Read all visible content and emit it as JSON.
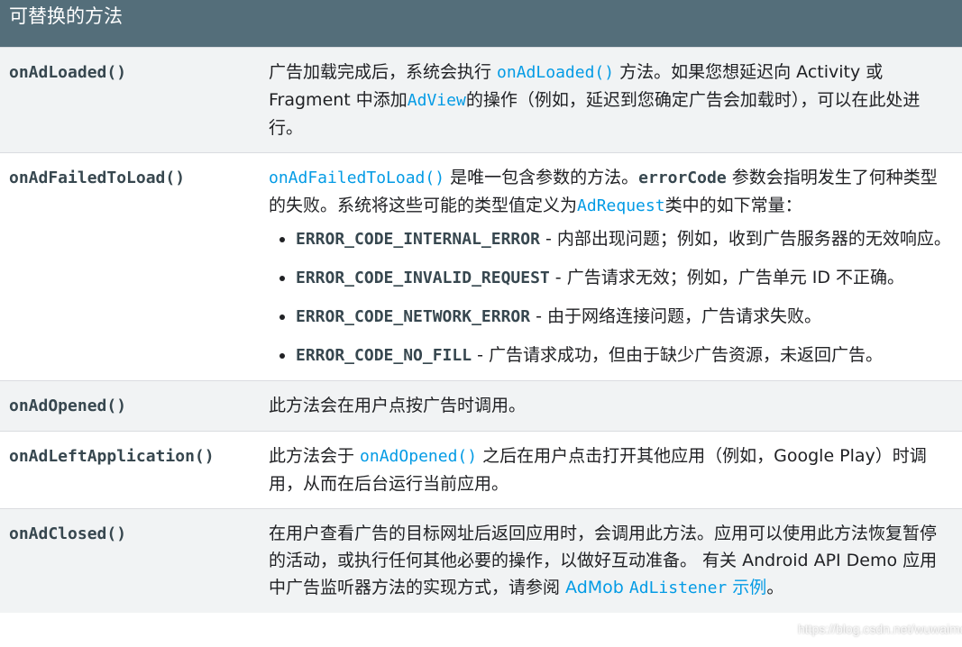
{
  "table": {
    "header_title": "可替换的方法",
    "rows": [
      {
        "method": "onAdLoaded()",
        "desc_pre": "广告加载完成后，系统会执行 ",
        "desc_link": "onAdLoaded()",
        "desc_mid": " 方法。如果您想延迟向 Activity 或 Fragment 中添加",
        "desc_link2": "AdView",
        "desc_post": "的操作（例如，延迟到您确定广告会加载时），可以在此处进行。"
      },
      {
        "method": "onAdFailedToLoad()",
        "desc_link": "onAdFailedToLoad()",
        "desc_mid": " 是唯一包含参数的方法。",
        "desc_code": "errorCode",
        "desc_mid2": " 参数会指明发生了何种类型的失败。系统将这些可能的类型值定义为",
        "desc_link2": "AdRequest",
        "desc_post": "类中的如下常量：",
        "errors": [
          {
            "code": "ERROR_CODE_INTERNAL_ERROR",
            "text": " - 内部出现问题；例如，收到广告服务器的无效响应。"
          },
          {
            "code": "ERROR_CODE_INVALID_REQUEST",
            "text": " - 广告请求无效；例如，广告单元 ID 不正确。"
          },
          {
            "code": "ERROR_CODE_NETWORK_ERROR",
            "text": " - 由于网络连接问题，广告请求失败。"
          },
          {
            "code": "ERROR_CODE_NO_FILL",
            "text": " - 广告请求成功，但由于缺少广告资源，未返回广告。"
          }
        ]
      },
      {
        "method": "onAdOpened()",
        "desc": "此方法会在用户点按广告时调用。"
      },
      {
        "method": "onAdLeftApplication()",
        "desc_pre": "此方法会于 ",
        "desc_link": "onAdOpened()",
        "desc_post": " 之后在用户点击打开其他应用（例如，Google Play）时调用，从而在后台运行当前应用。"
      },
      {
        "method": "onAdClosed()",
        "desc_pre": "在用户查看广告的目标网址后返回应用时，会调用此方法。应用可以使用此方法恢复暂停的活动，或执行任何其他必要的操作，以做好互动准备。 有关 Android API Demo 应用中广告监听器方法的实现方式，请参阅 ",
        "desc_link": "AdMob ",
        "desc_link_code": "AdListener",
        "desc_link_post": " 示例",
        "desc_post": "。"
      }
    ]
  },
  "watermark": "https://blog.csdn.net/wuwaimei"
}
